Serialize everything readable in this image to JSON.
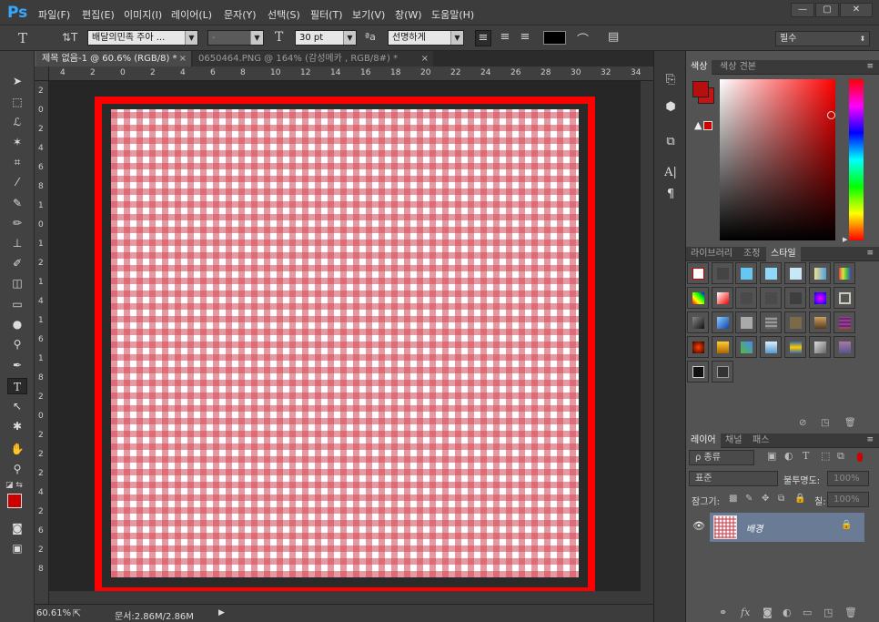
{
  "app": {
    "logo": "Ps"
  },
  "menu": [
    "파일(F)",
    "편집(E)",
    "이미지(I)",
    "레이어(L)",
    "문자(Y)",
    "선택(S)",
    "필터(T)",
    "보기(V)",
    "창(W)",
    "도움말(H)"
  ],
  "window_buttons": {
    "minimize": "—",
    "maximize": "▢",
    "close": "✕"
  },
  "options": {
    "tool_icon": "T",
    "font_family": "배달의민족 주아 ...",
    "font_style": "-",
    "font_size": "30 pt",
    "aa_icon": "ªa",
    "antialias": "선명하게",
    "workspace": "필수"
  },
  "tabs": [
    {
      "label": "제목 없음-1 @ 60.6% (RGB/8) *",
      "close": "×"
    },
    {
      "label": "0650464.PNG @ 164% (감성메카 , RGB/8#) *",
      "close": "×"
    }
  ],
  "ruler": {
    "h": [
      "4",
      "2",
      "0",
      "2",
      "4",
      "6",
      "8",
      "10",
      "12",
      "14",
      "16",
      "18",
      "20",
      "22",
      "24",
      "26",
      "28",
      "30",
      "32",
      "34"
    ],
    "v": [
      "2",
      "0",
      "2",
      "4",
      "6",
      "8",
      "1",
      "0",
      "1",
      "2",
      "1",
      "4",
      "1",
      "6",
      "1",
      "8",
      "2",
      "0",
      "2",
      "2",
      "2",
      "4",
      "2",
      "6",
      "2",
      "8"
    ]
  },
  "status": {
    "zoom": "60.61%",
    "doc": "문서:2.86M/2.86M",
    "arrow": "▶"
  },
  "color_panel": {
    "tabs": [
      "색상",
      "색상 견본"
    ],
    "foreground": "#b50f0f",
    "background": "#c41414"
  },
  "styles_panel": {
    "tabs": [
      "라이브러리",
      "조정",
      "스타일"
    ]
  },
  "layers_panel": {
    "tabs": [
      "레이어",
      "채널",
      "패스"
    ],
    "filter_kind": "ρ 종류",
    "blend_mode": "표준",
    "opacity_label": "불투명도:",
    "opacity_value": "100%",
    "lock_label": "잠그기:",
    "fill_label": "칠:",
    "fill_value": "100%",
    "layers": [
      {
        "name": "배경",
        "visible": true,
        "locked": true
      }
    ]
  },
  "colors": {
    "accent_red": "#ff0000",
    "gingham": "#d24655"
  }
}
